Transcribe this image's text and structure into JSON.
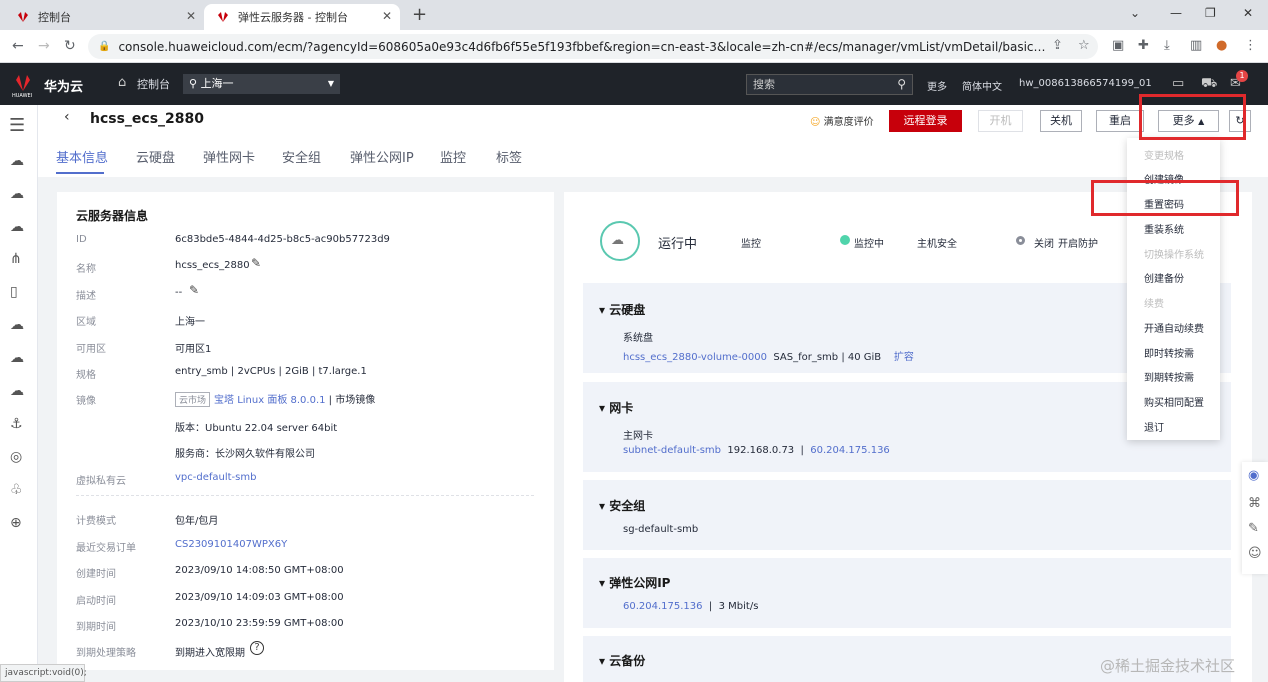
{
  "browser": {
    "tabs": [
      {
        "title": "控制台"
      },
      {
        "title": "弹性云服务器 - 控制台"
      }
    ],
    "url": "console.huaweicloud.com/ecm/?agencyId=608605a0e93c4d6fb6f55e5f193fbbef&region=cn-east-3&locale=zh-cn#/ecs/manager/vmList/vmDetail/basicinfo?instance...",
    "status_url": "javascript:void(0);"
  },
  "header": {
    "logo_text": "HUAWEI",
    "brand": "华为云",
    "console": "控制台",
    "region": "上海一",
    "search_placeholder": "搜索",
    "more": "更多",
    "lang": "简体中文",
    "user": "hw_008613866574199_01",
    "badge": "1"
  },
  "page": {
    "title": "hcss_ecs_2880",
    "satisfaction": "满意度评价",
    "tabs": [
      "基本信息",
      "云硬盘",
      "弹性网卡",
      "安全组",
      "弹性公网IP",
      "监控",
      "标签"
    ],
    "buttons": {
      "remote": "远程登录",
      "on": "开机",
      "off": "关机",
      "restart": "重启",
      "more": "更多"
    }
  },
  "info": {
    "title": "云服务器信息",
    "rows": [
      {
        "k": "ID",
        "v": "6c83bde5-4844-4d25-b8c5-ac90b57723d9"
      },
      {
        "k": "名称",
        "v": "hcss_ecs_2880"
      },
      {
        "k": "描述",
        "v": "--"
      },
      {
        "k": "区域",
        "v": "上海一"
      },
      {
        "k": "可用区",
        "v": "可用区1"
      },
      {
        "k": "规格",
        "v": "entry_smb | 2vCPUs | 2GiB | t7.large.1"
      },
      {
        "k": "镜像",
        "tag": "云市场",
        "link": "宝塔 Linux 面板 8.0.0.1",
        "v": " | 市场镜像"
      },
      {
        "k": "",
        "v": "版本：Ubuntu 22.04 server 64bit"
      },
      {
        "k": "",
        "v": "服务商：长沙网久软件有限公司"
      },
      {
        "k": "虚拟私有云",
        "v": "vpc-default-smb"
      },
      {
        "k": "计费模式",
        "v": "包年/包月"
      },
      {
        "k": "最近交易订单",
        "v": "CS2309101407WPX6Y"
      },
      {
        "k": "创建时间",
        "v": "2023/09/10 14:08:50 GMT+08:00"
      },
      {
        "k": "启动时间",
        "v": "2023/09/10 14:09:03 GMT+08:00"
      },
      {
        "k": "到期时间",
        "v": "2023/10/10 23:59:59 GMT+08:00"
      },
      {
        "k": "到期处理策略",
        "v": "到期进入宽限期"
      }
    ]
  },
  "status": {
    "state": "运行中",
    "monitor_label": "监控",
    "monitor_state": "监控中",
    "security_label": "主机安全",
    "security_state": "关闭",
    "security_link": "开启防护"
  },
  "sections": {
    "disk": {
      "title": "云硬盘",
      "sub": "系统盘",
      "name": "hcss_ecs_2880-volume-0000",
      "detail": "SAS_for_smb  |  40 GiB",
      "action": "扩容"
    },
    "nic": {
      "title": "网卡",
      "sub": "主网卡",
      "name": "subnet-default-smb",
      "ip": "192.168.0.73",
      "eip": "60.204.175.136"
    },
    "sg": {
      "title": "安全组",
      "name": "sg-default-smb"
    },
    "eip": {
      "title": "弹性公网IP",
      "ip": "60.204.175.136",
      "bw": "3 Mbit/s"
    },
    "backup": {
      "title": "云备份"
    }
  },
  "menu": [
    {
      "label": "变更规格",
      "disabled": true
    },
    {
      "label": "创建镜像",
      "disabled": false
    },
    {
      "label": "重置密码",
      "disabled": false
    },
    {
      "label": "重装系统",
      "disabled": false
    },
    {
      "label": "切换操作系统",
      "disabled": true
    },
    {
      "label": "创建备份",
      "disabled": false
    },
    {
      "label": "续费",
      "disabled": true
    },
    {
      "label": "开通自动续费",
      "disabled": false
    },
    {
      "label": "即时转按需",
      "disabled": false
    },
    {
      "label": "到期转按需",
      "disabled": false
    },
    {
      "label": "购买相同配置",
      "disabled": false
    },
    {
      "label": "退订",
      "disabled": false
    }
  ],
  "watermark": "@稀土掘金技术社区",
  "colors": {
    "brand_red": "#c7000b",
    "highlight": "#e0292c",
    "link": "#526ecc",
    "running": "#50d4ab"
  }
}
